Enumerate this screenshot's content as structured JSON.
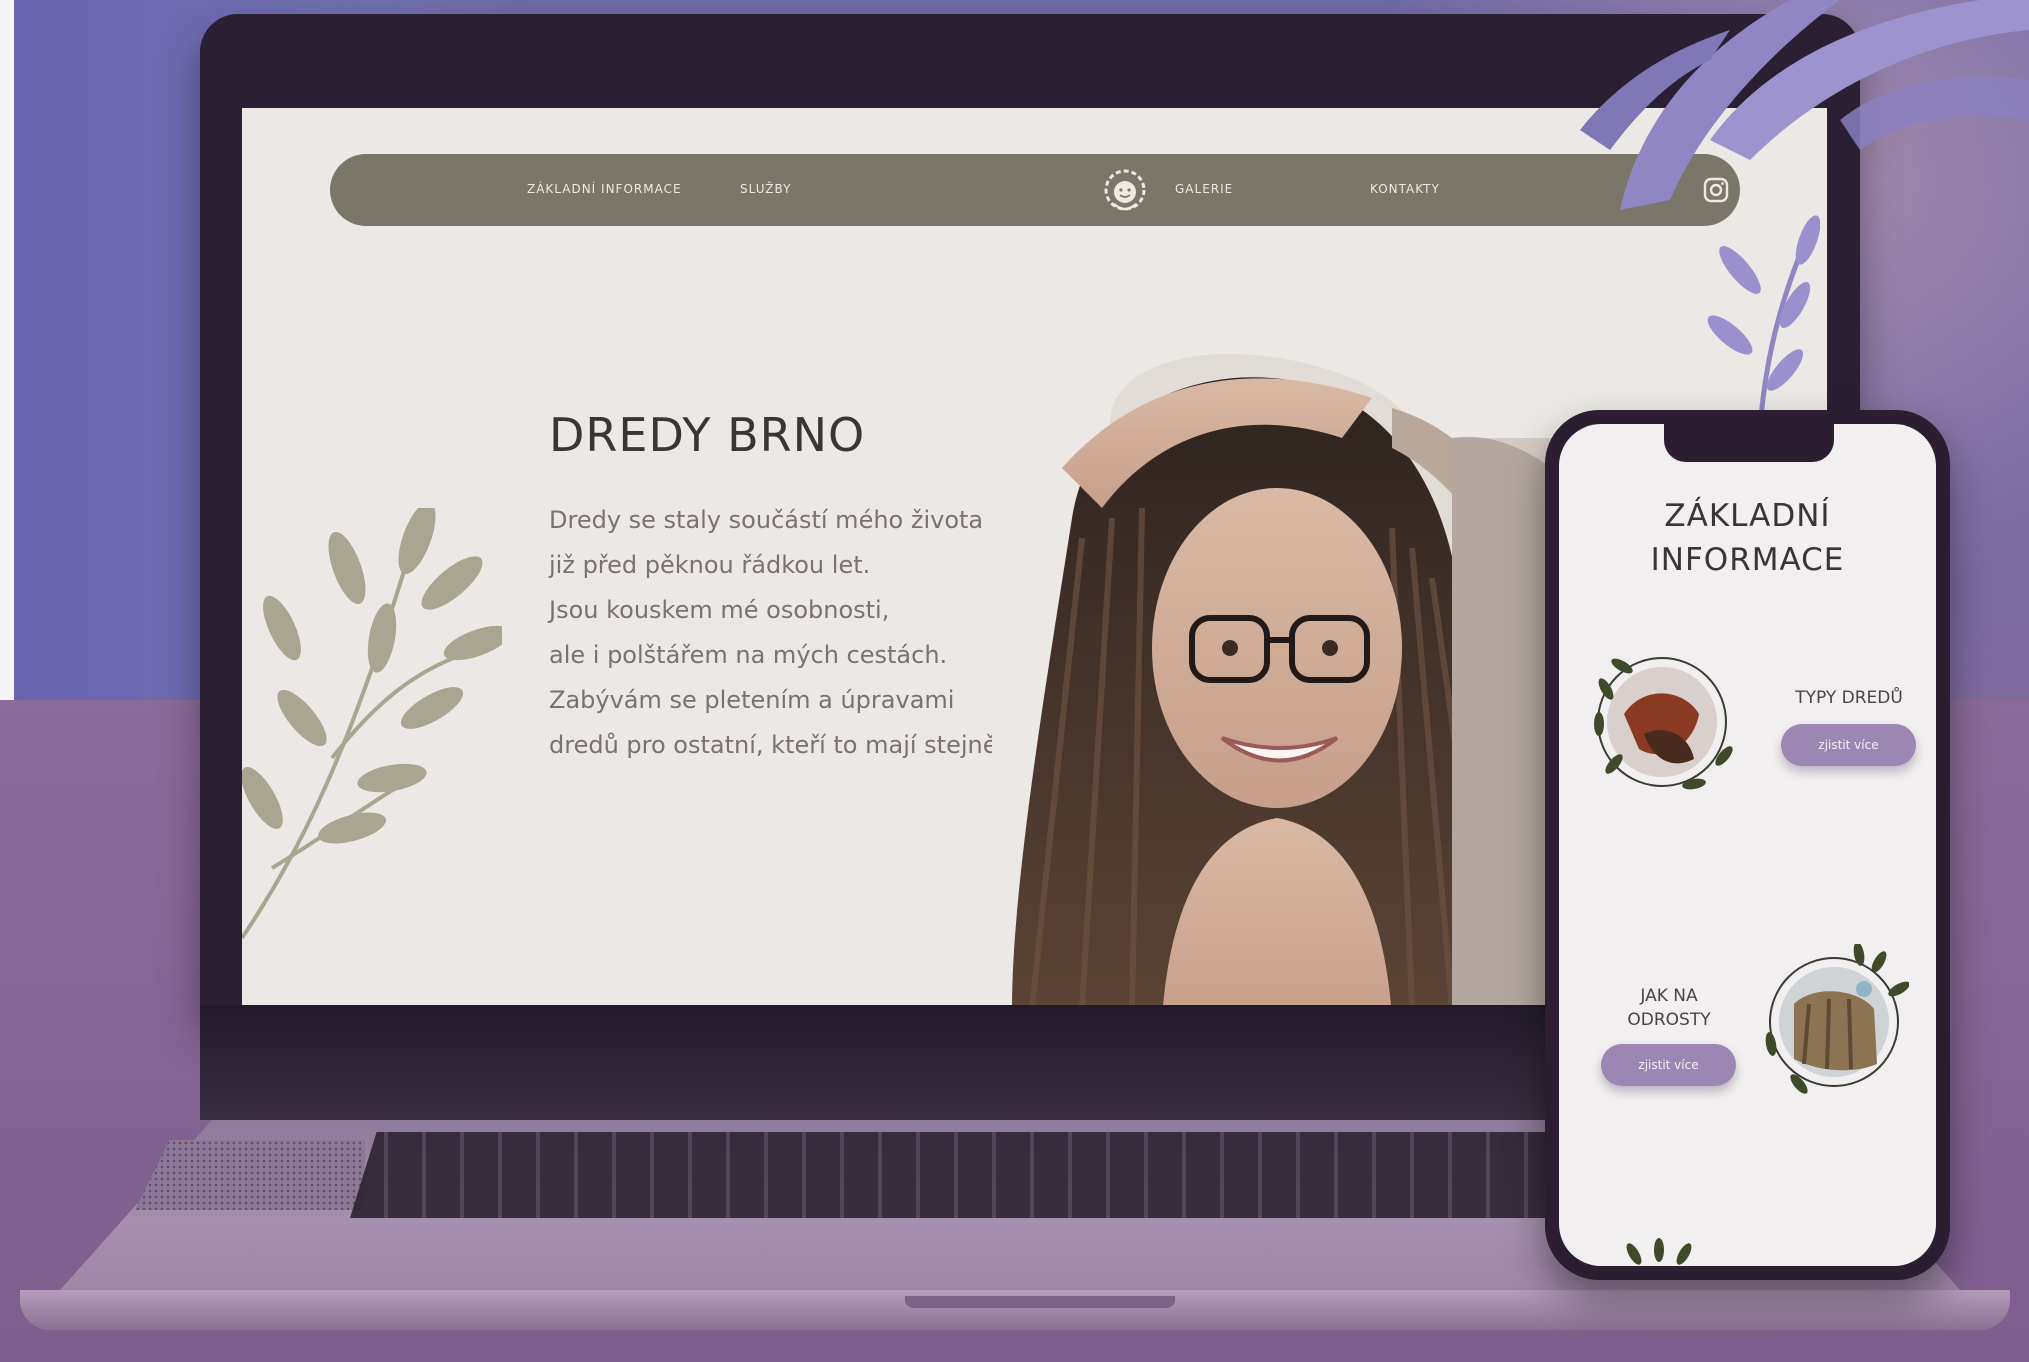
{
  "colors": {
    "nav_bar": "#7b766a",
    "screen_bg": "#ebe8e5",
    "accent_purple": "#9c86b4",
    "leaf_olive": "#a9a590",
    "heading_text": "#3b3437",
    "body_text": "#7b7170"
  },
  "nav": {
    "items": [
      {
        "label": "ZÁKLADNÍ INFORMACE"
      },
      {
        "label": "SLUŽBY"
      },
      {
        "label": "GALERIE"
      },
      {
        "label": "KONTAKTY"
      }
    ],
    "logo_icon": "dreadlocks-face-logo-icon",
    "social_icons": [
      "facebook-icon",
      "instagram-icon"
    ]
  },
  "hero": {
    "title": "DREDY BRNO",
    "lines": [
      "Dredy se staly součástí mého života",
      "již před pěknou řádkou let.",
      "Jsou kouskem mé osobnosti,",
      "ale i polštářem na mých cestách.",
      "Zabývám se pletením a úpravami",
      "dredů pro ostatní, kteří to mají stejně."
    ]
  },
  "phone": {
    "title_lines": [
      "ZÁKLADNÍ",
      "INFORMACE"
    ],
    "cards": [
      {
        "label_lines": [
          "TYPY DREDŮ"
        ],
        "button": "zjistit více"
      },
      {
        "label_lines": [
          "JAK NA",
          "ODROSTY"
        ],
        "button": "zjistit více"
      }
    ]
  }
}
